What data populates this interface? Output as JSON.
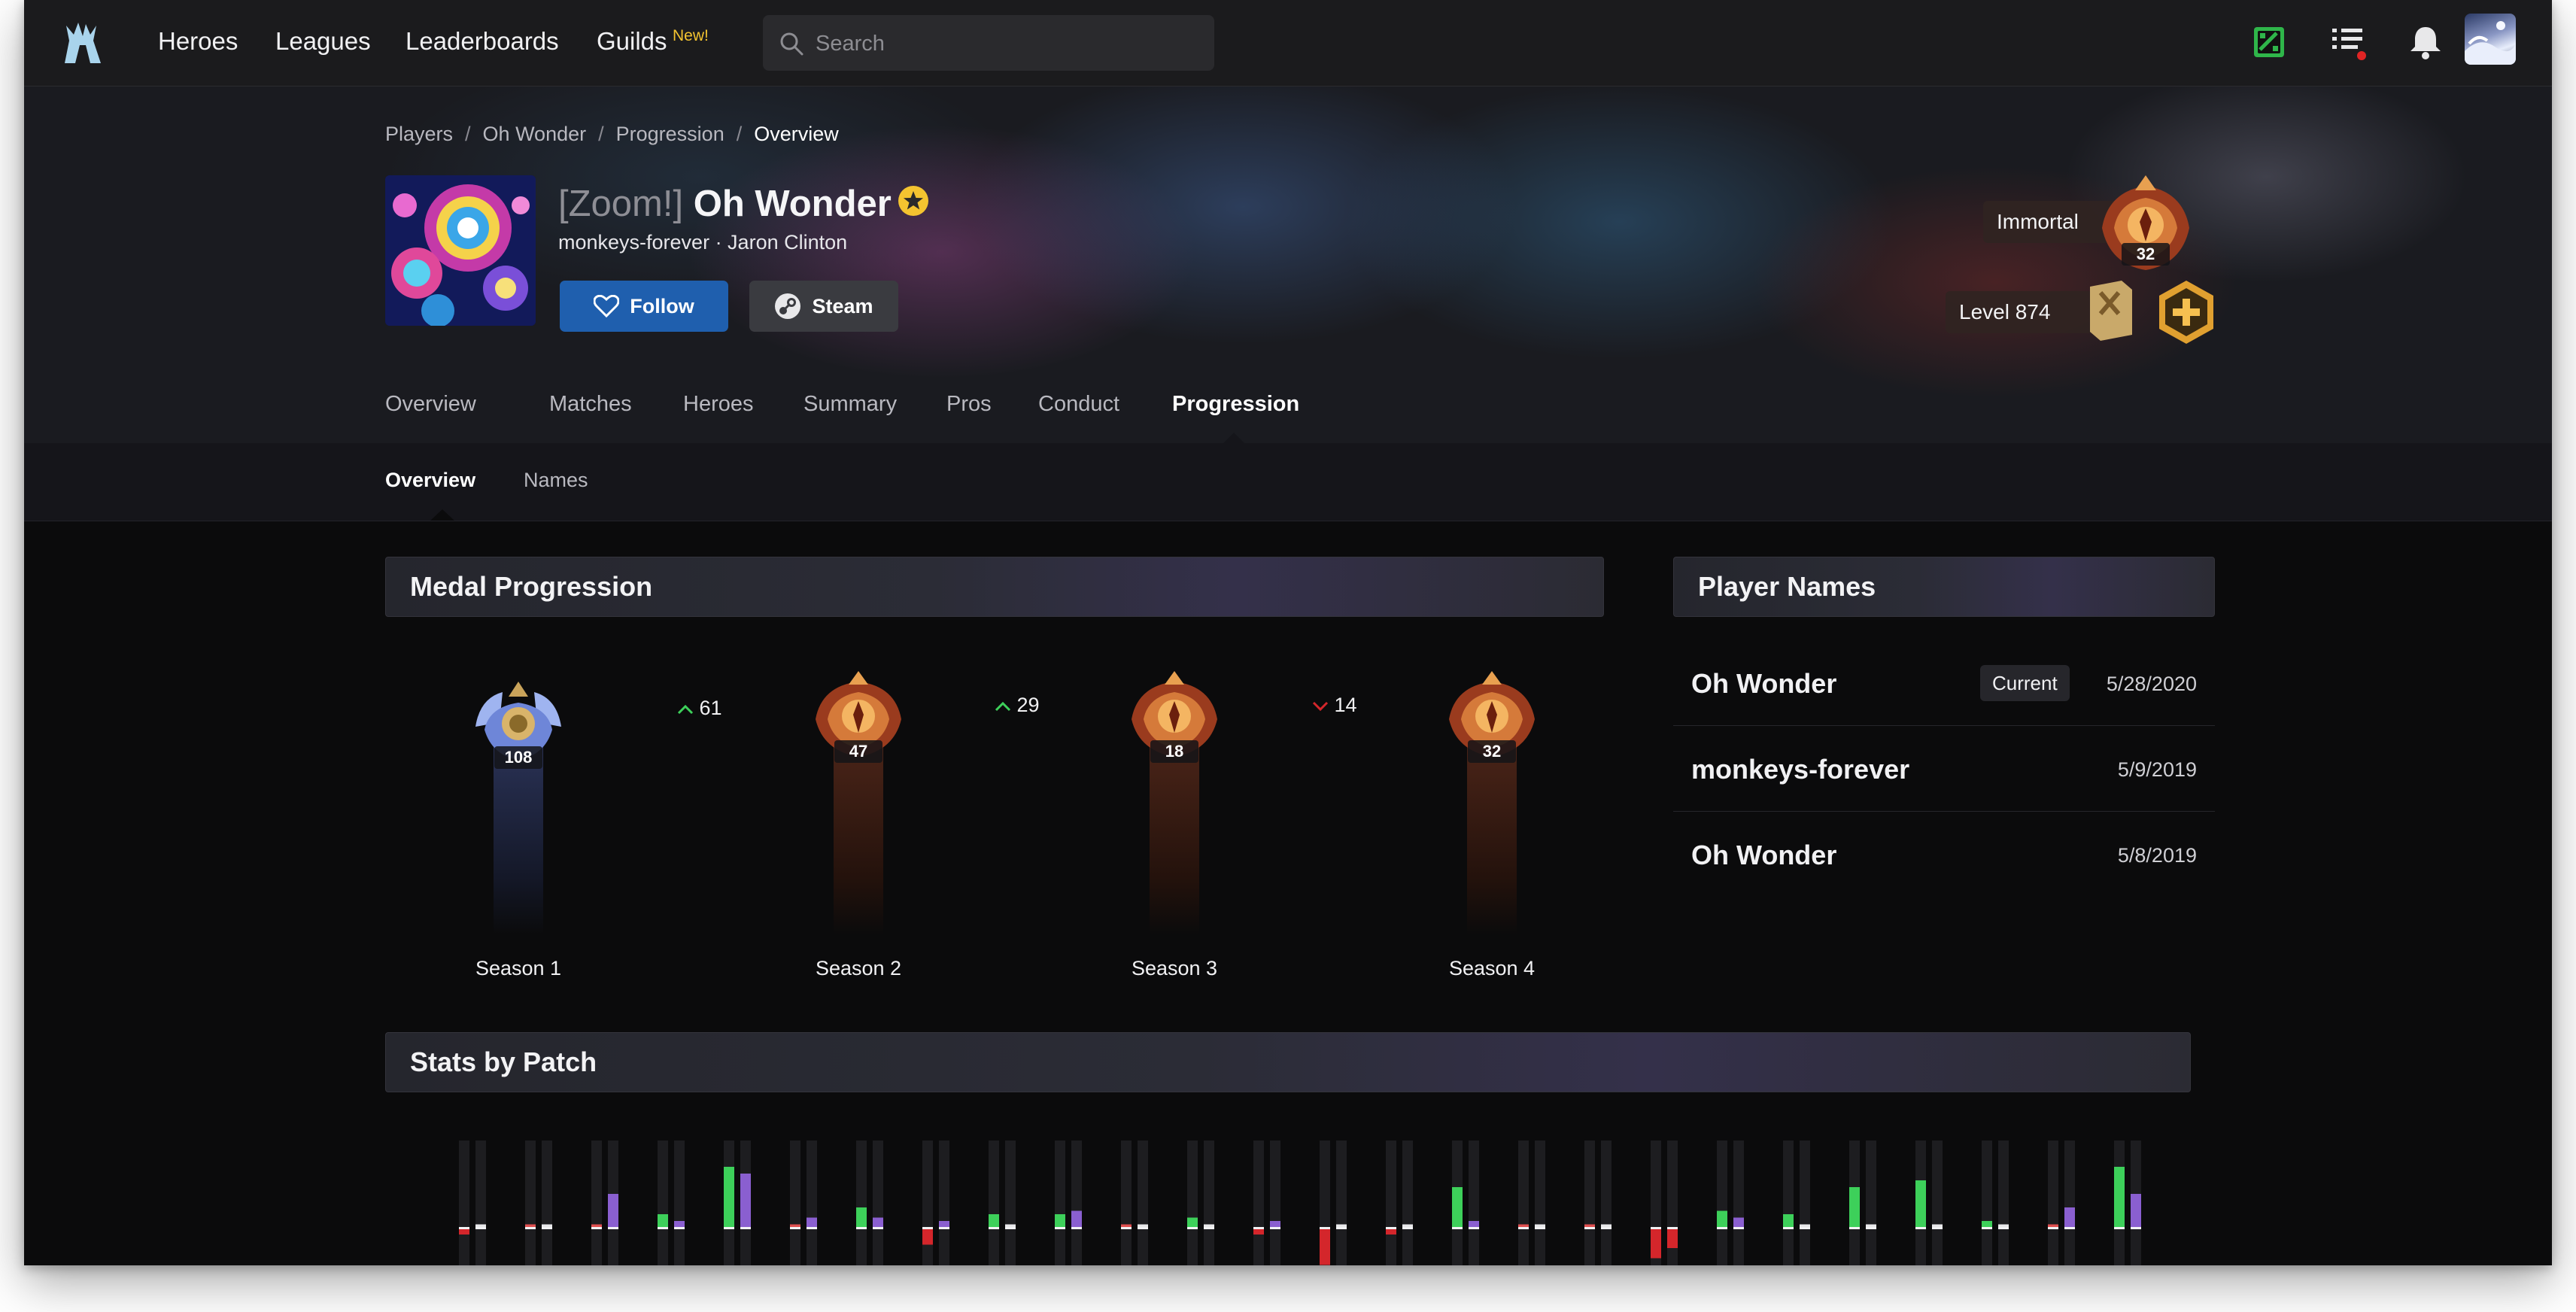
{
  "nav": {
    "links": [
      "Heroes",
      "Leagues",
      "Leaderboards",
      "Guilds"
    ],
    "new_tag": "New!",
    "search_placeholder": "Search"
  },
  "breadcrumb": [
    "Players",
    "Oh Wonder",
    "Progression",
    "Overview"
  ],
  "player": {
    "team_tag": "[Zoom!]",
    "name": "Oh Wonder",
    "subline": "monkeys-forever · Jaron Clinton",
    "follow_label": "Follow",
    "steam_label": "Steam",
    "rank_label": "Immortal",
    "rank_number": "32",
    "level_label": "Level 874"
  },
  "tabs": [
    "Overview",
    "Matches",
    "Heroes",
    "Summary",
    "Pros",
    "Conduct",
    "Progression"
  ],
  "active_tab": "Progression",
  "subtabs": [
    "Overview",
    "Names"
  ],
  "active_subtab": "Overview",
  "medal_progression": {
    "title": "Medal Progression",
    "seasons": [
      {
        "label": "Season 1",
        "rank": "108",
        "tier": "immortal-silver"
      },
      {
        "label": "Season 2",
        "rank": "47",
        "tier": "immortal"
      },
      {
        "label": "Season 3",
        "rank": "18",
        "tier": "immortal"
      },
      {
        "label": "Season 4",
        "rank": "32",
        "tier": "immortal"
      }
    ],
    "deltas": [
      {
        "direction": "up",
        "value": "61"
      },
      {
        "direction": "up",
        "value": "29"
      },
      {
        "direction": "down",
        "value": "14"
      }
    ]
  },
  "player_names": {
    "title": "Player Names",
    "current_badge": "Current",
    "rows": [
      {
        "name": "Oh Wonder",
        "date": "5/28/2020",
        "current": true
      },
      {
        "name": "monkeys-forever",
        "date": "5/9/2019",
        "current": false
      },
      {
        "name": "Oh Wonder",
        "date": "5/8/2019",
        "current": false
      }
    ]
  },
  "stats_by_patch": {
    "title": "Stats by Patch"
  },
  "chart_data": {
    "type": "bar",
    "series": [
      {
        "values": [
          -0.1,
          0.05,
          0.05,
          0.2,
          0.9,
          0.05,
          0.3,
          -0.25,
          0.2,
          0.2,
          0.05,
          0.15,
          -0.1,
          -0.55,
          -0.1,
          0.6,
          0.05,
          0.05,
          -0.45,
          0.25,
          0.2,
          0.6,
          0.7,
          0.1,
          0.05,
          0.9
        ]
      },
      {
        "values": [
          0.05,
          0.05,
          0.5,
          0.1,
          0.8,
          0.15,
          0.15,
          0.1,
          0.05,
          0.25,
          0.05,
          0.05,
          0.1,
          0.05,
          0.05,
          0.1,
          0.05,
          0.05,
          -0.3,
          0.15,
          0.05,
          0.05,
          0.05,
          0.05,
          0.3,
          0.5
        ]
      }
    ],
    "colors": {
      "positive": "#3dd05a",
      "negative": "#d4262b",
      "secondary": "#8a5fd0"
    }
  },
  "colors": {
    "accent_blue": "#1f5fae",
    "nav_bg": "#1b1b1d",
    "page_bg": "#0b0b0c",
    "gold": "#f4c430"
  },
  "icons": [
    "dota-logo-icon",
    "search-icon",
    "dota2-icon",
    "list-icon",
    "bell-icon",
    "heart-icon",
    "steam-icon",
    "star-badge-icon"
  ]
}
